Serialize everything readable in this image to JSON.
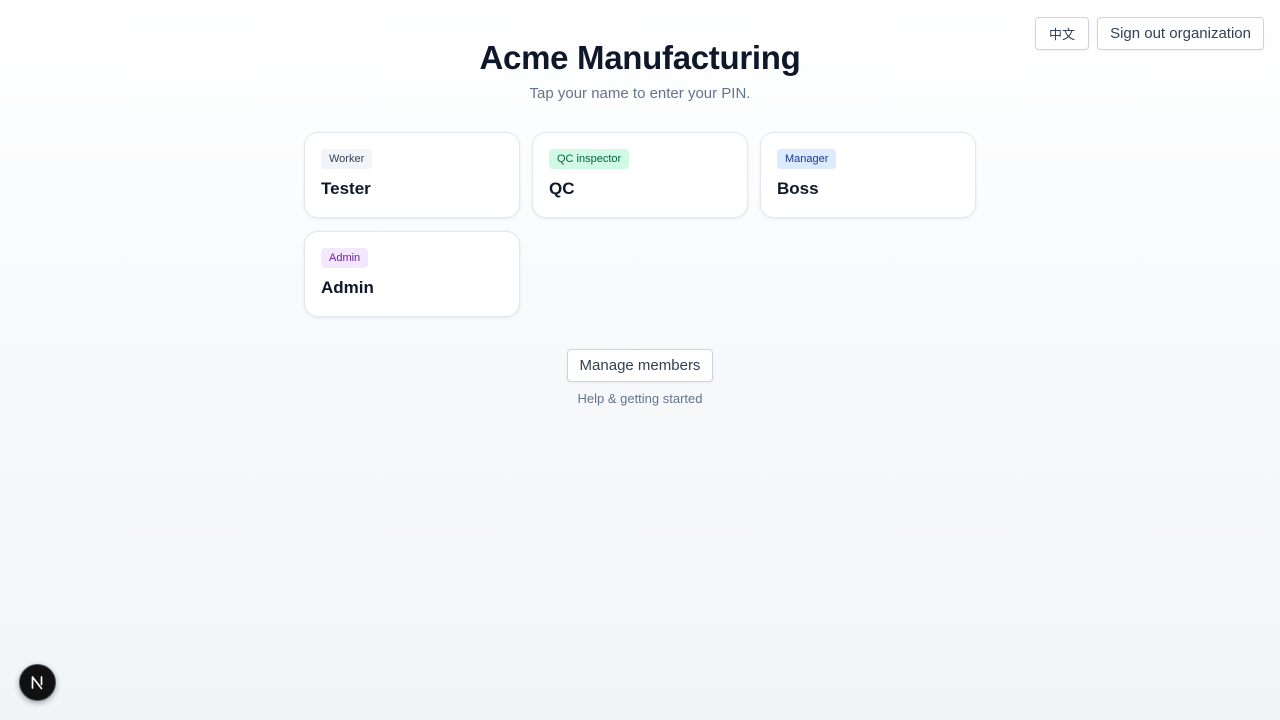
{
  "header": {
    "title": "Acme Manufacturing",
    "subtitle": "Tap your name to enter your PIN."
  },
  "top_actions": {
    "language_label": "中文",
    "sign_out_label": "Sign out organization"
  },
  "members": [
    {
      "role": "Worker",
      "name": "Tester",
      "badge_bg": "#f1f5f9",
      "badge_fg": "#334155"
    },
    {
      "role": "QC inspector",
      "name": "QC",
      "badge_bg": "#d1fae5",
      "badge_fg": "#065f46"
    },
    {
      "role": "Manager",
      "name": "Boss",
      "badge_bg": "#dbeafe",
      "badge_fg": "#1e3a8a"
    },
    {
      "role": "Admin",
      "name": "Admin",
      "badge_bg": "#f3e8ff",
      "badge_fg": "#6b21a8"
    }
  ],
  "footer": {
    "manage_label": "Manage members",
    "help_label": "Help & getting started"
  },
  "dev_indicator": {
    "icon": "next-logo-icon"
  }
}
